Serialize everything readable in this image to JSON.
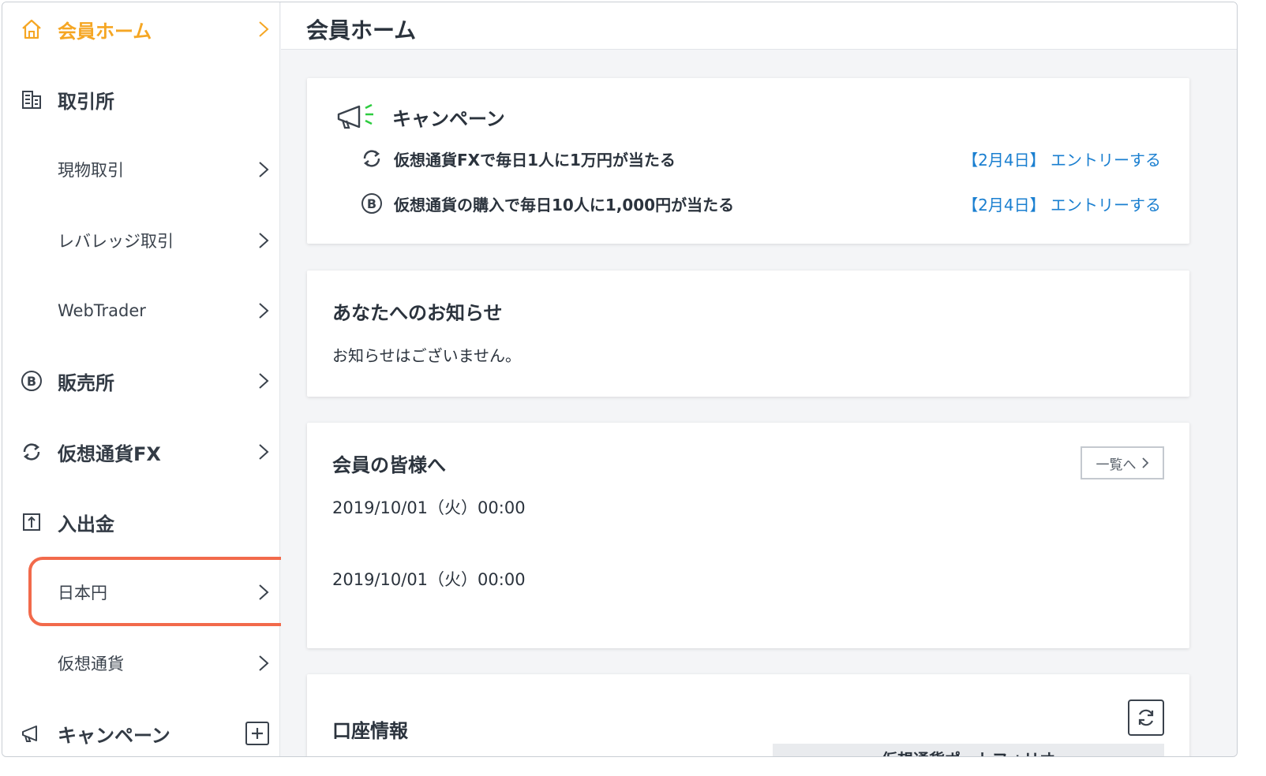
{
  "sidebar": {
    "home": "会員ホーム",
    "exchange": "取引所",
    "spot": "現物取引",
    "leverage": "レバレッジ取引",
    "webtrader": "WebTrader",
    "shop": "販売所",
    "fx": "仮想通貨FX",
    "deposit": "入出金",
    "jpy": "日本円",
    "crypto": "仮想通貨",
    "campaign": "キャンペーン"
  },
  "header": {
    "title": "会員ホーム"
  },
  "campaign": {
    "title": "キャンペーン",
    "items": [
      {
        "text": "仮想通貨FXで毎日1人に1万円が当たる",
        "link": "【2月4日】 エントリーする"
      },
      {
        "text": "仮想通貨の購入で毎日10人に1,000円が当たる",
        "link": "【2月4日】 エントリーする"
      }
    ]
  },
  "notices": {
    "title": "あなたへのお知らせ",
    "empty": "お知らせはございません。"
  },
  "members": {
    "title": "会員の皆様へ",
    "list_button": "一覧へ",
    "items": [
      "2019/10/01（火）00:00",
      "2019/10/01（火）00:00"
    ]
  },
  "account": {
    "title": "口座情報",
    "portfolio": "仮想通貨ポートフォリオ"
  },
  "colors": {
    "accent": "#f5a623",
    "link": "#1a7fd0",
    "highlight": "#f26a4b"
  }
}
